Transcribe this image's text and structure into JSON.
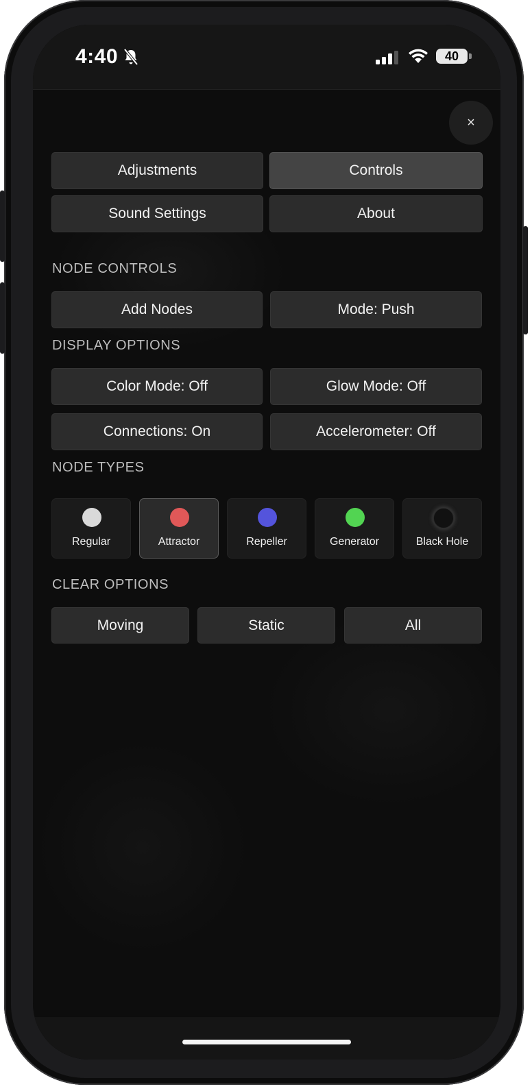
{
  "status_bar": {
    "time": "4:40",
    "battery_level": "40",
    "icons": [
      "bell-slash-icon",
      "cellular-signal-icon",
      "wifi-icon",
      "battery-icon"
    ]
  },
  "close_label": "×",
  "tabs": [
    {
      "label": "Adjustments",
      "active": false
    },
    {
      "label": "Controls",
      "active": true
    },
    {
      "label": "Sound Settings",
      "active": false
    },
    {
      "label": "About",
      "active": false
    }
  ],
  "node_controls": {
    "heading": "NODE CONTROLS",
    "add_nodes": "Add Nodes",
    "mode": "Mode: Push"
  },
  "display_options": {
    "heading": "DISPLAY OPTIONS",
    "color_mode": "Color Mode: Off",
    "glow_mode": "Glow Mode: Off",
    "connections": "Connections: On",
    "accelerometer": "Accelerometer: Off"
  },
  "node_types": {
    "heading": "NODE TYPES",
    "selected": "Attractor",
    "items": [
      {
        "label": "Regular",
        "color": "#d9d9d9"
      },
      {
        "label": "Attractor",
        "color": "#e05858"
      },
      {
        "label": "Repeller",
        "color": "#5454dc"
      },
      {
        "label": "Generator",
        "color": "#52d452"
      },
      {
        "label": "Black Hole",
        "color": "#111111"
      }
    ]
  },
  "clear_options": {
    "heading": "CLEAR OPTIONS",
    "moving": "Moving",
    "static": "Static",
    "all": "All"
  }
}
